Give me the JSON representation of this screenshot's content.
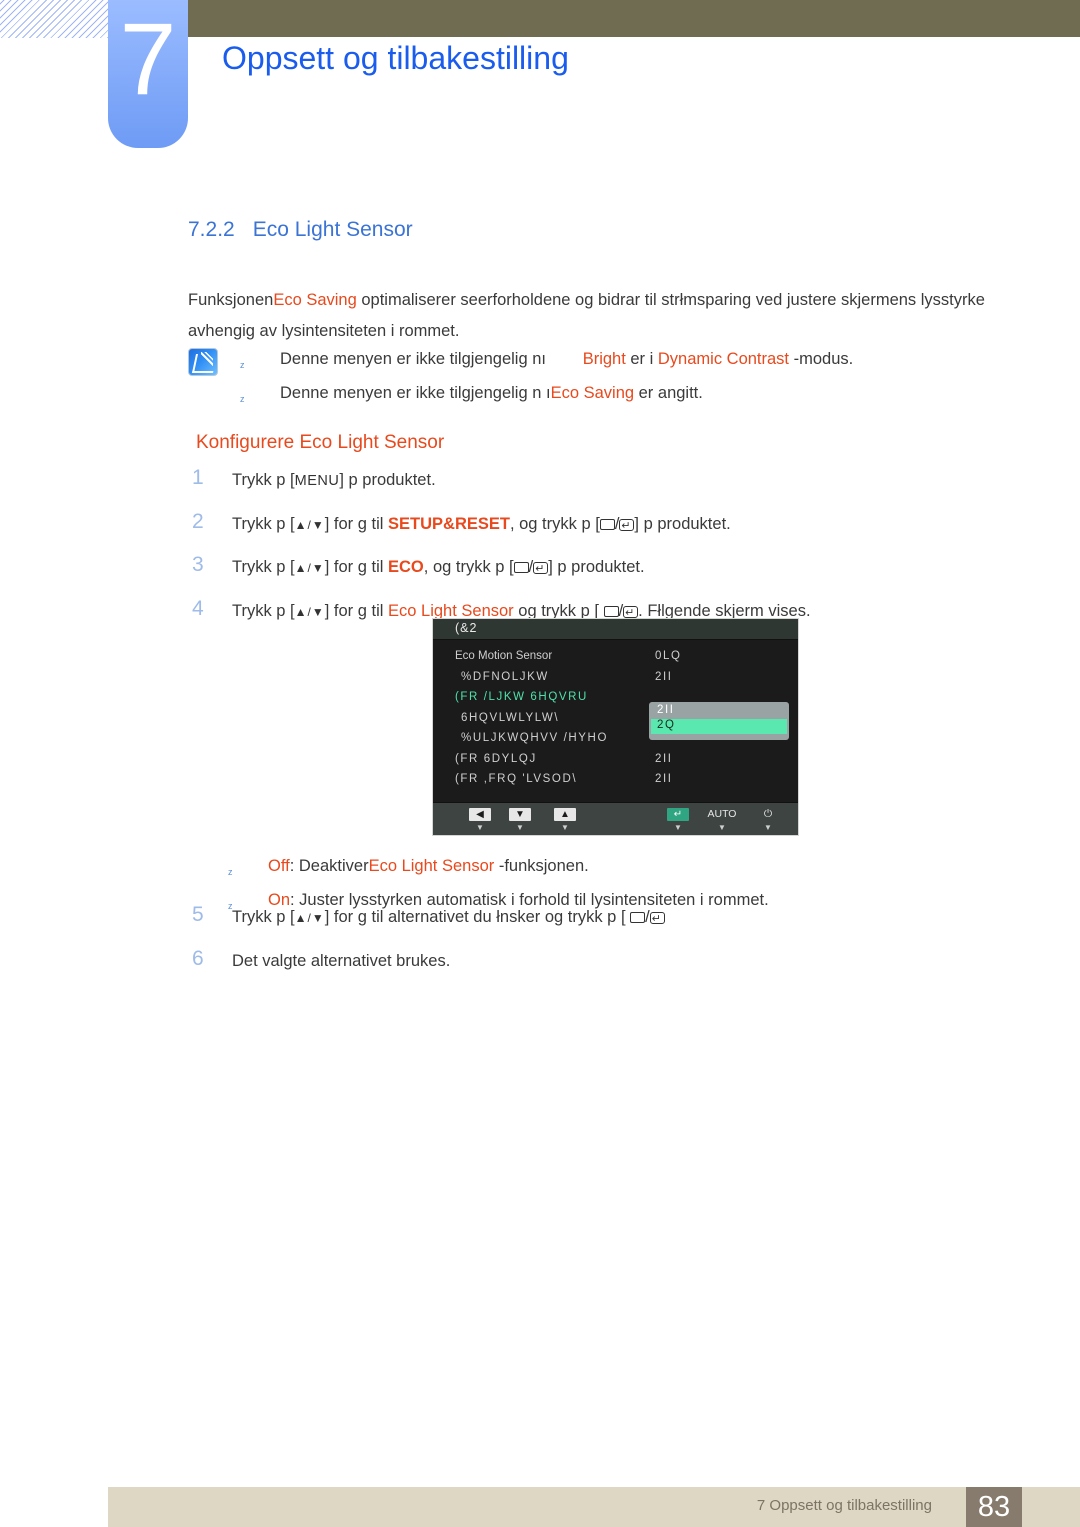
{
  "header": {
    "chapter_number": "7",
    "chapter_title": "Oppsett og tilbakestilling"
  },
  "section": {
    "number": "7.2.2",
    "title": "Eco Light Sensor",
    "intro_part1": "Funksjonen",
    "intro_keyword": "Eco Saving",
    "intro_part2": " optimaliserer seerforholdene og bidrar til strłmsparing ved  justere skjermens lysstyrke avhengig av lysintensiteten i rommet."
  },
  "notes": [
    {
      "text_before": "Denne menyen er ikke tilgjengelig nı",
      "gap": "        ",
      "kw1": "Bright",
      "mid": " er i ",
      "kw2": "Dynamic Contrast",
      "text_after": " -modus."
    },
    {
      "text_before": "Denne menyen er ikke tilgjengelig n ı",
      "kw1": "Eco Saving",
      "text_after": " er angitt."
    }
  ],
  "subheading": "Konfigurere Eco Light Sensor",
  "steps": [
    {
      "num": "1",
      "a": "Trykk p  [",
      "key": "MENU",
      "b": "] p  produktet.",
      "c": "",
      "d": ""
    },
    {
      "num": "2",
      "a": "Trykk p  [",
      "arrows": "▲/▼",
      "b": "] for  g  til  ",
      "kw": "SETUP&RESET",
      "c": ", og trykk p  [",
      "d": "] p  produktet."
    },
    {
      "num": "3",
      "a": "Trykk p  [",
      "arrows": "▲/▼",
      "b": "] for  g  til  ",
      "kw": "ECO",
      "c": ", og trykk p  [",
      "d": "] p  produktet."
    },
    {
      "num": "4",
      "a": "Trykk p  [",
      "arrows": "▲/▼",
      "b": "] for  g  til  ",
      "kw": "Eco Light Sensor",
      "c": " og trykk p  [ ",
      "d": ". Fłlgende skjerm vises."
    }
  ],
  "options": [
    {
      "kw": "Off",
      "mid": ": Deaktiver",
      "kw2": "Eco Light Sensor",
      "tail": " -funksjonen."
    },
    {
      "kw": "On",
      "mid": ": Juster lysstyrken automatisk i forhold til lysintensiteten i rommet.",
      "kw2": "",
      "tail": ""
    }
  ],
  "steps2": [
    {
      "num": "5",
      "a": "Trykk p  [",
      "arrows": "▲/▼",
      "b": "] for  g  til alternativet du łnsker og trykk p  [ ",
      "c": "",
      "d": ""
    },
    {
      "num": "6",
      "a": "Det valgte alternativet brukes.",
      "arrows": "",
      "b": "",
      "c": "",
      "d": ""
    }
  ],
  "osd": {
    "title": "(&2",
    "rows": [
      {
        "label": "Eco Motion Sensor",
        "value": "0LQ",
        "selected": false,
        "plain": true,
        "indent": false
      },
      {
        "label": "%DFNOLJKW",
        "value": "2II",
        "selected": false,
        "plain": false,
        "indent": true
      },
      {
        "label": "(FR /LJKW 6HQVRU",
        "value": "",
        "selected": true,
        "plain": false,
        "indent": false
      },
      {
        "label": "6HQVLWLYLW\\",
        "value": "",
        "selected": false,
        "plain": false,
        "indent": true
      },
      {
        "label": "%ULJKWQHVV /HYHO",
        "value": "",
        "selected": false,
        "plain": false,
        "indent": true
      },
      {
        "label": "(FR 6DYLQJ",
        "value": "2II",
        "selected": false,
        "plain": false,
        "indent": false
      },
      {
        "label": "(FR ,FRQ 'LVSOD\\",
        "value": "2II",
        "selected": false,
        "plain": false,
        "indent": false
      }
    ],
    "popup": {
      "option_off": "2II",
      "option_on": "2Q"
    },
    "buttons": [
      {
        "cap": "◀",
        "type": "cap",
        "tick": "▼"
      },
      {
        "cap": "▼",
        "type": "cap",
        "tick": "▼"
      },
      {
        "cap": "▲",
        "type": "cap",
        "tick": "▼"
      },
      {
        "cap": "↵",
        "type": "green",
        "tick": "▼"
      },
      {
        "cap": "AUTO",
        "type": "text",
        "tick": "▼"
      },
      {
        "cap": "⏻",
        "type": "text",
        "tick": "▼"
      }
    ]
  },
  "footer": {
    "text": "7 Oppsett og tilbakestilling",
    "page": "83"
  },
  "colors": {
    "accent_orange": "#e8491d",
    "accent_blue": "#3b74d4",
    "chapter_blue": "#1a5ced",
    "olive": "#706c52",
    "footer_bar": "#ddd7c3",
    "footer_page": "#877b6d",
    "osd_green": "#4ee2ab"
  }
}
